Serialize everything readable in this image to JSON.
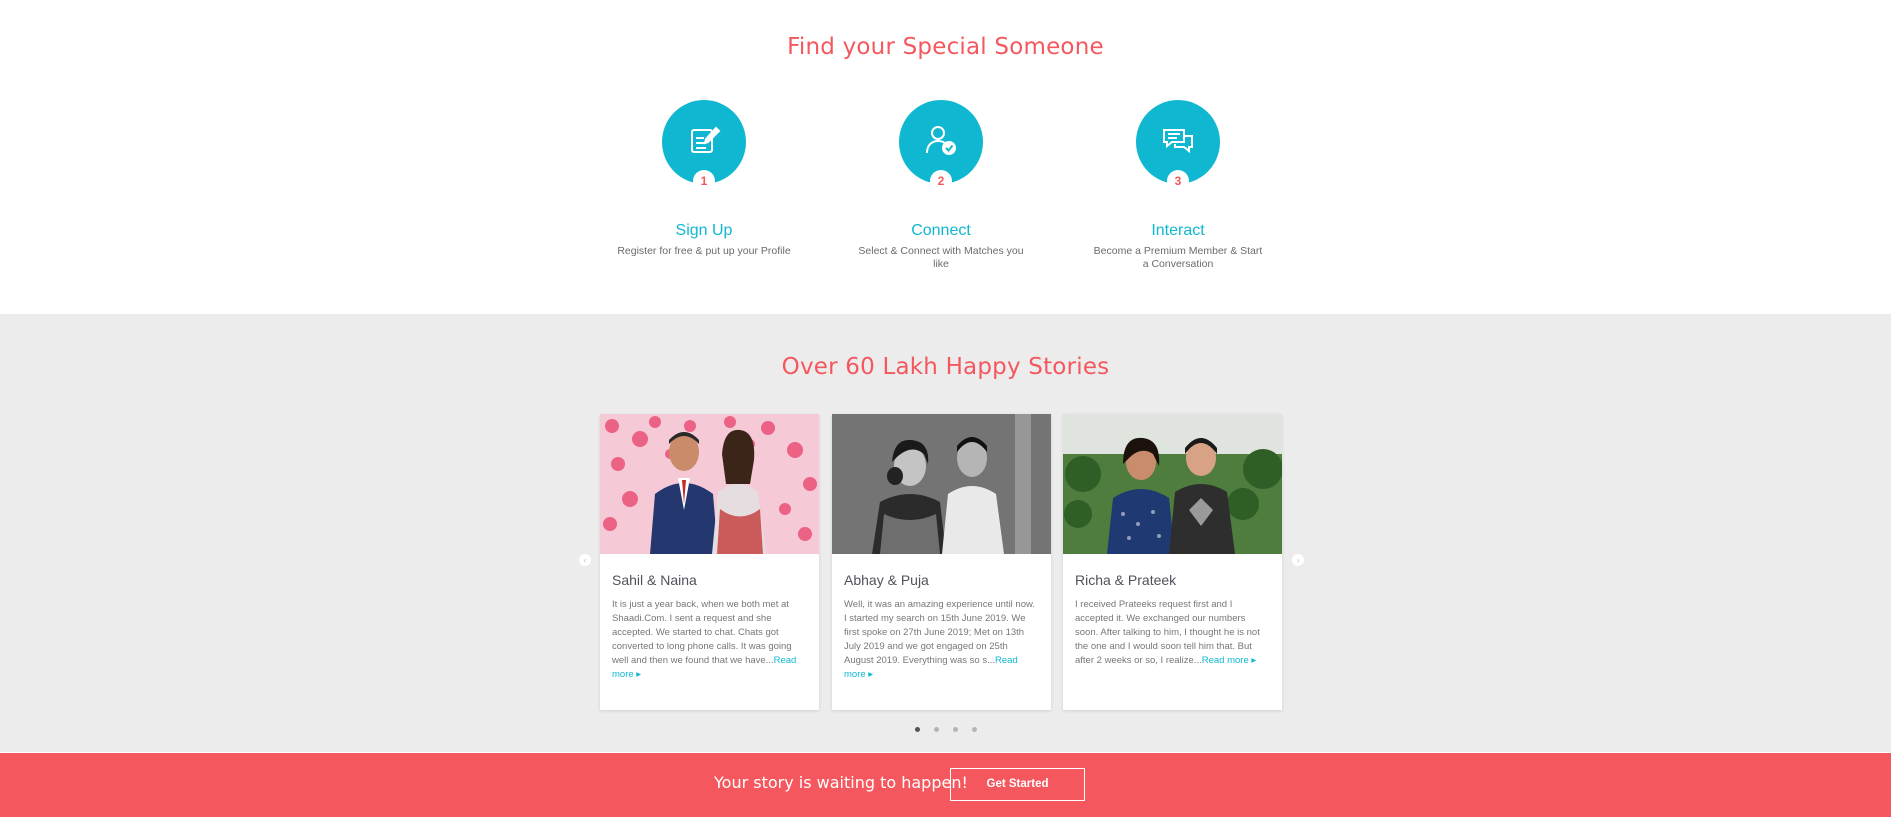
{
  "steps_section": {
    "title": "Find your Special Someone",
    "steps": [
      {
        "number": "1",
        "icon": "edit-form-icon",
        "title": "Sign Up",
        "description": "Register for free & put up your Profile"
      },
      {
        "number": "2",
        "icon": "user-check-icon",
        "title": "Connect",
        "description": "Select & Connect with Matches you like"
      },
      {
        "number": "3",
        "icon": "chat-bubbles-icon",
        "title": "Interact",
        "description": "Become a Premium Member & Start a Conversation"
      }
    ]
  },
  "stories_section": {
    "title": "Over 60 Lakh Happy Stories",
    "stories": [
      {
        "names": "Sahil & Naina",
        "text": "It is just a year back, when we both met at Shaadi.Com. I sent a request and she accepted. We started to chat. Chats got converted to long phone calls. It was going well and then we found that we have...",
        "read_more": "Read more ▸"
      },
      {
        "names": "Abhay & Puja",
        "text": "Well, it was an amazing experience until now. I started my search on 15th June 2019. We first spoke on 27th June 2019; Met on 13th July 2019 and we got engaged on 25th August 2019. Everything was so s...",
        "read_more": "Read more ▸"
      },
      {
        "names": "Richa & Prateek",
        "text": "I received Prateeks request first and I accepted it. We exchanged our numbers soon. After talking to him, I thought he is not the one and I would soon tell him that. But after 2 weeks or so, I realize...",
        "read_more": "Read more ▸"
      }
    ],
    "prev_arrow": "‹",
    "next_arrow": "›",
    "dots_count": 4,
    "active_dot": 1
  },
  "cta": {
    "text": "Your story is waiting to happen!",
    "button_label": "Get Started"
  },
  "colors": {
    "accent_red": "#f4585e",
    "accent_teal": "#10b7d1",
    "stories_bg": "#ececec"
  }
}
